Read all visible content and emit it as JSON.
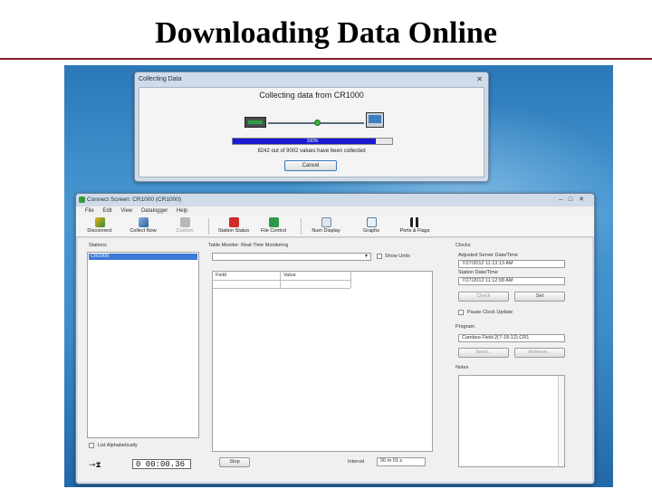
{
  "slide": {
    "title": "Downloading Data Online"
  },
  "collect_dialog": {
    "title": "Collecting Data",
    "heading": "Collecting data from CR1000",
    "progress_label": "100%",
    "progress_fraction": 0.9,
    "status": "8242 out of 9002 values have been collected",
    "cancel_label": "Cancel"
  },
  "connect_window": {
    "title": "Connect Screen: CR1000 (CR1000)",
    "menu": [
      "File",
      "Edit",
      "View",
      "Datalogger",
      "Help"
    ],
    "toolbar": {
      "disconnect": "Disconnect",
      "collect_now": "Collect Now",
      "custom": "Custom",
      "station_status": "Station Status",
      "file_control": "File Control",
      "num_display": "Num Display",
      "graphs": "Graphs",
      "ports_flags": "Ports & Flags"
    },
    "stations": {
      "label": "Stations",
      "items": [
        "CR1000"
      ],
      "list_alpha_label": "List Alphabetically"
    },
    "table_monitor": {
      "label": "Table Monitor: Real-Time Monitoring",
      "table_select": "",
      "show_units_label": "Show Units",
      "columns": [
        "Field",
        "Value"
      ],
      "stop_label": "Stop",
      "interval_label": "Interval",
      "interval_value": "00 m 01 s"
    },
    "clocks": {
      "label": "Clocks",
      "adjusted_label": "Adjusted Server Date/Time",
      "adjusted_value": "7/27/2012 11:13:13 AM",
      "station_label": "Station Date/Time",
      "station_value": "7/27/2012 11:12:08 AM",
      "check_label": "Check",
      "set_label": "Set",
      "pause_label": "Pause Clock Update"
    },
    "program": {
      "label": "Program",
      "value": "Cambea Field-2(7-18-12).CR1",
      "send_label": "Send...",
      "retrieve_label": "Retrieve..."
    },
    "notes": {
      "label": "Notes"
    },
    "elapsed_timer": "0 00:00.36"
  }
}
